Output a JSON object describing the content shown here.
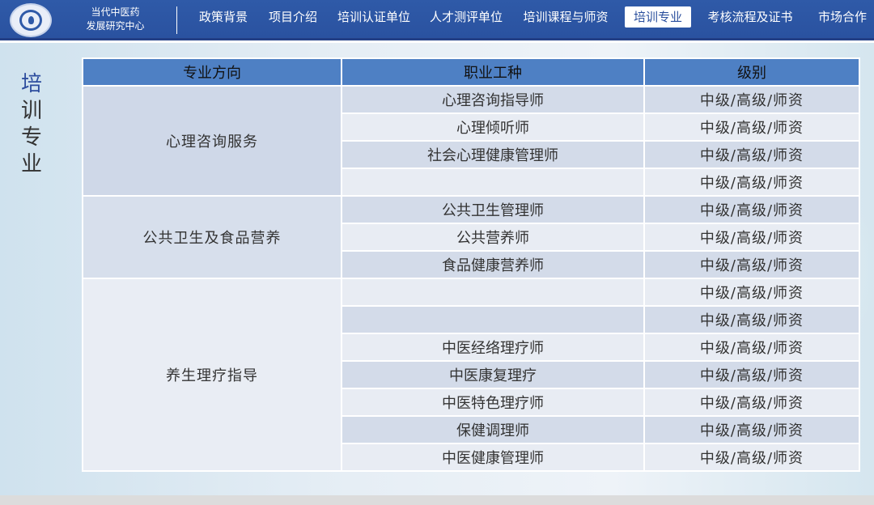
{
  "header": {
    "org_line1": "当代中医药",
    "org_line2": "发展研究中心",
    "nav": [
      {
        "label": "政策背景",
        "active": false
      },
      {
        "label": "项目介绍",
        "active": false
      },
      {
        "label": "培训认证单位",
        "active": false
      },
      {
        "label": "人才测评单位",
        "active": false
      },
      {
        "label": "培训课程与师资",
        "active": false
      },
      {
        "label": "培训专业",
        "active": true
      },
      {
        "label": "考核流程及证书",
        "active": false
      },
      {
        "label": "市场合作",
        "active": false
      }
    ]
  },
  "page_title": [
    "培",
    "训",
    "专",
    "业"
  ],
  "table": {
    "headers": {
      "direction": "专业方向",
      "job": "职业工种",
      "level": "级别"
    },
    "groups": [
      {
        "direction": "心理咨询服务",
        "rows": [
          {
            "job": "心理咨询指导师",
            "level": "中级/高级/师资"
          },
          {
            "job": "心理倾听师",
            "level": "中级/高级/师资"
          },
          {
            "job": "社会心理健康管理师",
            "level": "中级/高级/师资"
          },
          {
            "job": "",
            "level": "中级/高级/师资"
          }
        ]
      },
      {
        "direction": "公共卫生及食品营养",
        "rows": [
          {
            "job": "公共卫生管理师",
            "level": "中级/高级/师资"
          },
          {
            "job": "公共营养师",
            "level": "中级/高级/师资"
          },
          {
            "job": "食品健康营养师",
            "level": "中级/高级/师资"
          }
        ]
      },
      {
        "direction": "养生理疗指导",
        "rows": [
          {
            "job": "",
            "level": "中级/高级/师资"
          },
          {
            "job": "",
            "level": "中级/高级/师资"
          },
          {
            "job": "中医经络理疗师",
            "level": "中级/高级/师资"
          },
          {
            "job": "中医康复理疗",
            "level": "中级/高级/师资"
          },
          {
            "job": "中医特色理疗师",
            "level": "中级/高级/师资"
          },
          {
            "job": "保健调理师",
            "level": "中级/高级/师资"
          },
          {
            "job": "中医健康管理师",
            "level": "中级/高级/师资"
          }
        ]
      }
    ]
  },
  "colors": {
    "header_bg": "#2f5aa8",
    "table_header_bg": "#4e80c4",
    "row_dark": "#d3dbe9",
    "row_light": "#e8ecf3"
  }
}
